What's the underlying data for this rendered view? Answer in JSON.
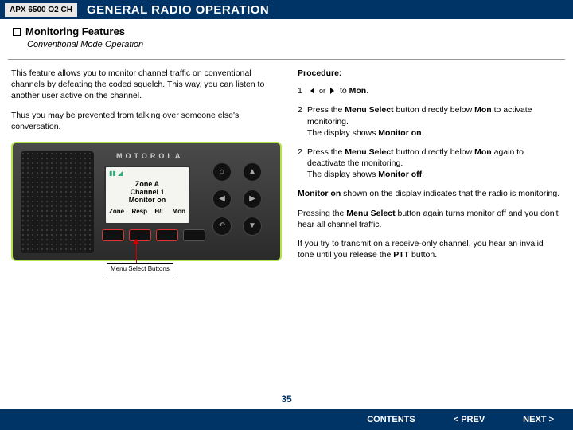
{
  "topbar": {
    "tag": "APX 6500 O2 CH",
    "title": "GENERAL RADIO OPERATION"
  },
  "section": {
    "title": "Monitoring Features",
    "sub": "Conventional Mode Operation"
  },
  "left": {
    "p1": "This feature allows you to monitor channel traffic on conventional channels by defeating the coded squelch. This way, you can listen to another user active on the channel.",
    "p2": "Thus you may be prevented from talking over someone else's conversation."
  },
  "radio": {
    "brand": "MOTOROLA",
    "zone": "Zone A",
    "channel": "Channel 1",
    "status": "Monitor on",
    "soft": [
      "Zone",
      "Resp",
      "H/L",
      "Mon"
    ],
    "callout": "Menu Select Buttons"
  },
  "right": {
    "proc": "Procedure:",
    "s1a": "",
    "s1_or": "or",
    "s1b": "to ",
    "s1b_bold": "Mon",
    "s1c": ".",
    "s2a": "Press the ",
    "s2b": "Menu Select",
    "s2c": " button directly below ",
    "s2d": "Mon",
    "s2e": " to activate monitoring.",
    "s2f": "The display shows ",
    "s2g": "Monitor on",
    "s2h": ".",
    "s3a": "Press the ",
    "s3b": "Menu Select",
    "s3c": " button directly below ",
    "s3d": "Mon",
    "s3e": " again to deactivate the monitoring.",
    "s3f": "The display shows ",
    "s3g": "Monitor off",
    "s3h": ".",
    "p4a": "Monitor on",
    "p4b": " shown on the display indicates that the radio is monitoring.",
    "p5a": "Pressing the ",
    "p5b": "Menu Select",
    "p5c": " button again turns monitor off and you don't hear all channel traffic.",
    "p6a": "If you try to transmit on a receive-only channel, you hear an invalid tone until you release the ",
    "p6b": "PTT",
    "p6c": " button."
  },
  "footer": {
    "page": "35",
    "contents": "CONTENTS",
    "prev": "< PREV",
    "next": "NEXT >"
  }
}
